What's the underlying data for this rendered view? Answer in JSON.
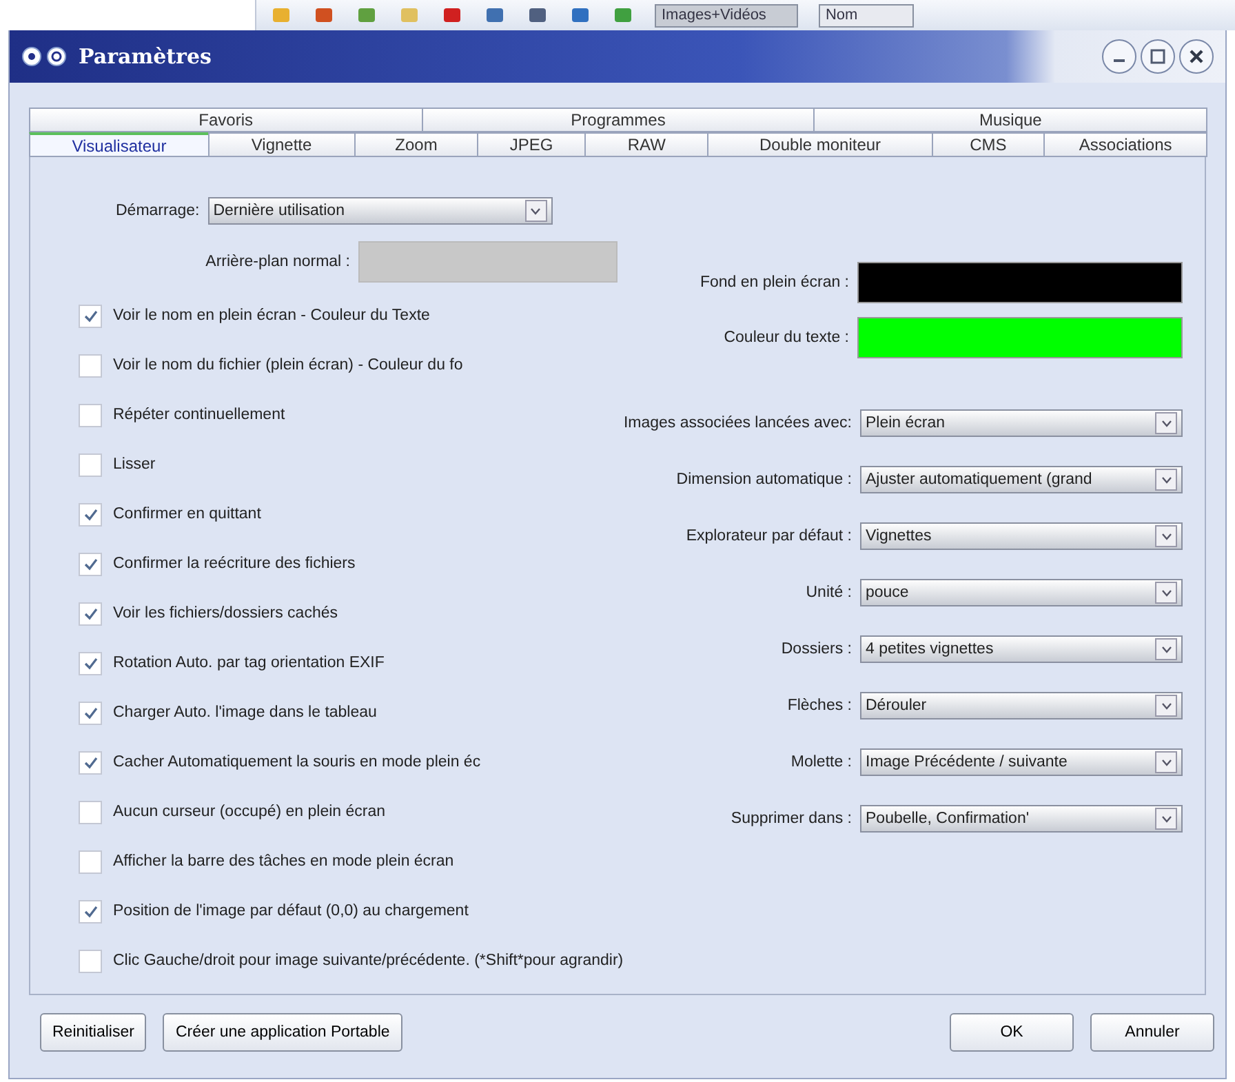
{
  "background_toolbar": {
    "filter": "Images+Vidéos",
    "sort": "Nom"
  },
  "window": {
    "title": "Paramètres"
  },
  "tabs_row_1": [
    {
      "label": "Favoris",
      "selected": false
    },
    {
      "label": "Programmes",
      "selected": false
    },
    {
      "label": "Musique",
      "selected": false
    }
  ],
  "tabs_row_2": [
    {
      "label": "Visualisateur",
      "selected": true
    },
    {
      "label": "Vignette",
      "selected": false
    },
    {
      "label": "Zoom",
      "selected": false
    },
    {
      "label": "JPEG",
      "selected": false
    },
    {
      "label": "RAW",
      "selected": false
    },
    {
      "label": "Double moniteur",
      "selected": false
    },
    {
      "label": "CMS",
      "selected": false
    },
    {
      "label": "Associations",
      "selected": false
    }
  ],
  "startup": {
    "label": "Démarrage:",
    "value": "Dernière utilisation"
  },
  "normal_background": {
    "label": "Arrière-plan normal :",
    "color": "#c8c8c8"
  },
  "fullscreen_background": {
    "label": "Fond en plein écran :",
    "color": "#000000"
  },
  "text_color": {
    "label": "Couleur du texte :",
    "color": "#00ff00"
  },
  "options": [
    {
      "label": "Voir le nom en plein écran - Couleur du Texte",
      "checked": true
    },
    {
      "label": "Voir le nom du fichier (plein écran) - Couleur du fo",
      "checked": false
    },
    {
      "label": "Répéter continuellement",
      "checked": false
    },
    {
      "label": "Lisser",
      "checked": false
    },
    {
      "label": "Confirmer en quittant",
      "checked": true
    },
    {
      "label": "Confirmer la reécriture des fichiers",
      "checked": true
    },
    {
      "label": "Voir les fichiers/dossiers cachés",
      "checked": true
    },
    {
      "label": "Rotation Auto. par tag orientation EXIF",
      "checked": true
    },
    {
      "label": "Charger Auto. l'image dans le tableau",
      "checked": true
    },
    {
      "label": "Cacher Automatiquement la souris en mode plein éc",
      "checked": true
    },
    {
      "label": "Aucun curseur (occupé) en plein écran",
      "checked": false
    },
    {
      "label": "Afficher la barre des tâches en mode plein écran",
      "checked": false
    },
    {
      "label": "Position de l'image par défaut (0,0) au chargement",
      "checked": true
    },
    {
      "label": "Clic Gauche/droit pour image suivante/précédente. (*Shift*pour agrandir)",
      "checked": false
    }
  ],
  "dropdowns": [
    {
      "label": "Images associées lancées avec:",
      "value": "Plein écran"
    },
    {
      "label": "Dimension automatique :",
      "value": "Ajuster automatiquement (grand"
    },
    {
      "label": "Explorateur par défaut :",
      "value": "Vignettes"
    },
    {
      "label": "Unité :",
      "value": "pouce"
    },
    {
      "label": "Dossiers :",
      "value": "4 petites vignettes"
    },
    {
      "label": "Flèches :",
      "value": "Dérouler"
    },
    {
      "label": "Molette :",
      "value": "Image Précédente / suivante"
    },
    {
      "label": "Supprimer dans :",
      "value": "Poubelle, Confirmation'"
    }
  ],
  "buttons_left": [
    "Reinitialiser",
    "Créer une application Portable"
  ],
  "buttons_right": [
    "OK",
    "Annuler"
  ]
}
